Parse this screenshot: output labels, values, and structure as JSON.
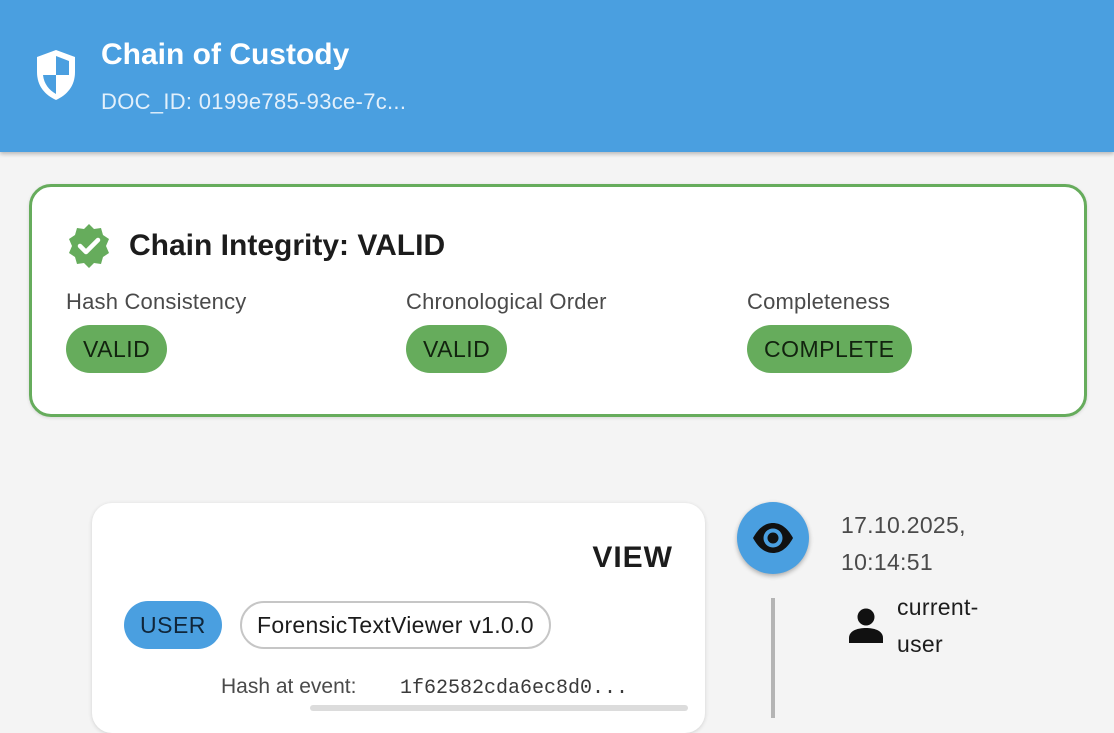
{
  "appbar": {
    "title": "Chain of Custody",
    "subtitle": "DOC_ID: 0199e785-93ce-7c...",
    "icon": "shield-icon",
    "color": "#4a9fe0"
  },
  "integrity": {
    "heading": "Chain Integrity: VALID",
    "icon": "verified-badge-icon",
    "accent": "#66ac5c",
    "metrics": [
      {
        "label": "Hash Consistency",
        "status": "VALID"
      },
      {
        "label": "Chronological Order",
        "status": "VALID"
      },
      {
        "label": "Completeness",
        "status": "COMPLETE"
      }
    ]
  },
  "events": [
    {
      "type": "VIEW",
      "role": "USER",
      "application": "ForensicTextViewer v1.0.0",
      "hash_label": "Hash at event:",
      "hash_value": "1f62582cda6ec8d0...",
      "timestamp_date": "17.10.2025,",
      "timestamp_time": "10:14:51",
      "user_line1": "current-",
      "user_line2": "user",
      "icon": "eye-icon"
    }
  ]
}
